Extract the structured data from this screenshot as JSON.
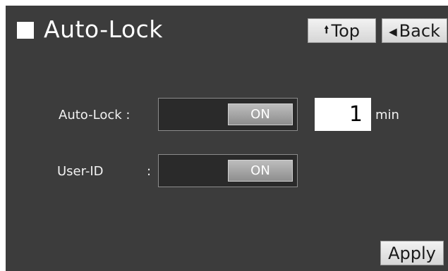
{
  "header": {
    "title": "Auto-Lock",
    "top_label": "Top",
    "back_label": "Back",
    "top_icon": "arrow-up-icon",
    "back_icon": "triangle-left-icon"
  },
  "settings": {
    "auto_lock": {
      "label": "Auto-Lock :",
      "state": "ON",
      "value": "1",
      "unit": "min"
    },
    "user_id": {
      "label": "User-ID",
      "colon": ":",
      "state": "ON"
    }
  },
  "footer": {
    "apply_label": "Apply"
  },
  "colors": {
    "background": "#3c3c3c",
    "button": "#e0e0e0",
    "field": "#ffffff"
  }
}
